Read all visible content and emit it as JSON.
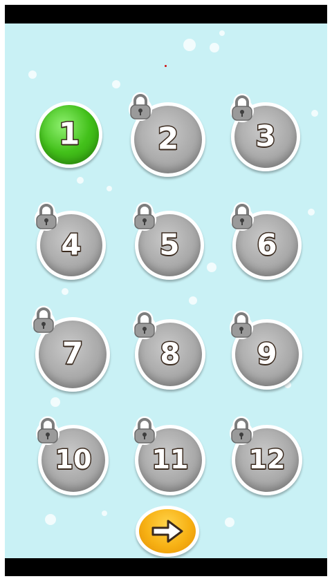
{
  "levels": [
    {
      "label": "1",
      "state": "unlocked"
    },
    {
      "label": "2",
      "state": "locked"
    },
    {
      "label": "3",
      "state": "locked"
    },
    {
      "label": "4",
      "state": "locked"
    },
    {
      "label": "5",
      "state": "locked"
    },
    {
      "label": "6",
      "state": "locked"
    },
    {
      "label": "7",
      "state": "locked"
    },
    {
      "label": "8",
      "state": "locked"
    },
    {
      "label": "9",
      "state": "locked"
    },
    {
      "label": "10",
      "state": "locked"
    },
    {
      "label": "11",
      "state": "locked"
    },
    {
      "label": "12",
      "state": "locked"
    }
  ],
  "next_button": {
    "icon": "arrow-right-icon"
  },
  "colors": {
    "background": "#c9f1f5",
    "unlocked": "#43c11b",
    "locked": "#a9a9a9",
    "next": "#f7b114",
    "outline": "#3a2a1e"
  }
}
